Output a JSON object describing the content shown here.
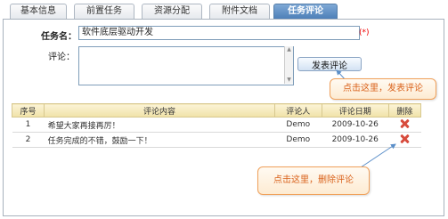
{
  "tabs": [
    {
      "label": "基本信息",
      "active": false
    },
    {
      "label": "前置任务",
      "active": false
    },
    {
      "label": "资源分配",
      "active": false
    },
    {
      "label": "附件文档",
      "active": false
    },
    {
      "label": "任务评论",
      "active": true
    }
  ],
  "form": {
    "task_name_label": "任务名：",
    "task_name_value": "软件底层驱动开发",
    "required_mark": "(*)",
    "comment_label": "评论：",
    "comment_value": "",
    "post_button": "发表评论"
  },
  "table": {
    "headers": [
      "序号",
      "评论内容",
      "评论人",
      "评论日期",
      "删除"
    ],
    "rows": [
      {
        "index": "1",
        "content": "希望大家再接再厉！",
        "author": "Demo",
        "date": "2009-10-26"
      },
      {
        "index": "2",
        "content": "任务完成的不错，鼓励一下！",
        "author": "Demo",
        "date": "2009-10-26"
      }
    ]
  },
  "callouts": {
    "post_hint": "点击这里，发表评论",
    "delete_hint": "点击这里，删除评论"
  },
  "colors": {
    "active_tab": "#4d7fb8",
    "callout_text": "#d9611a",
    "delete_icon": "#d74b3c"
  }
}
